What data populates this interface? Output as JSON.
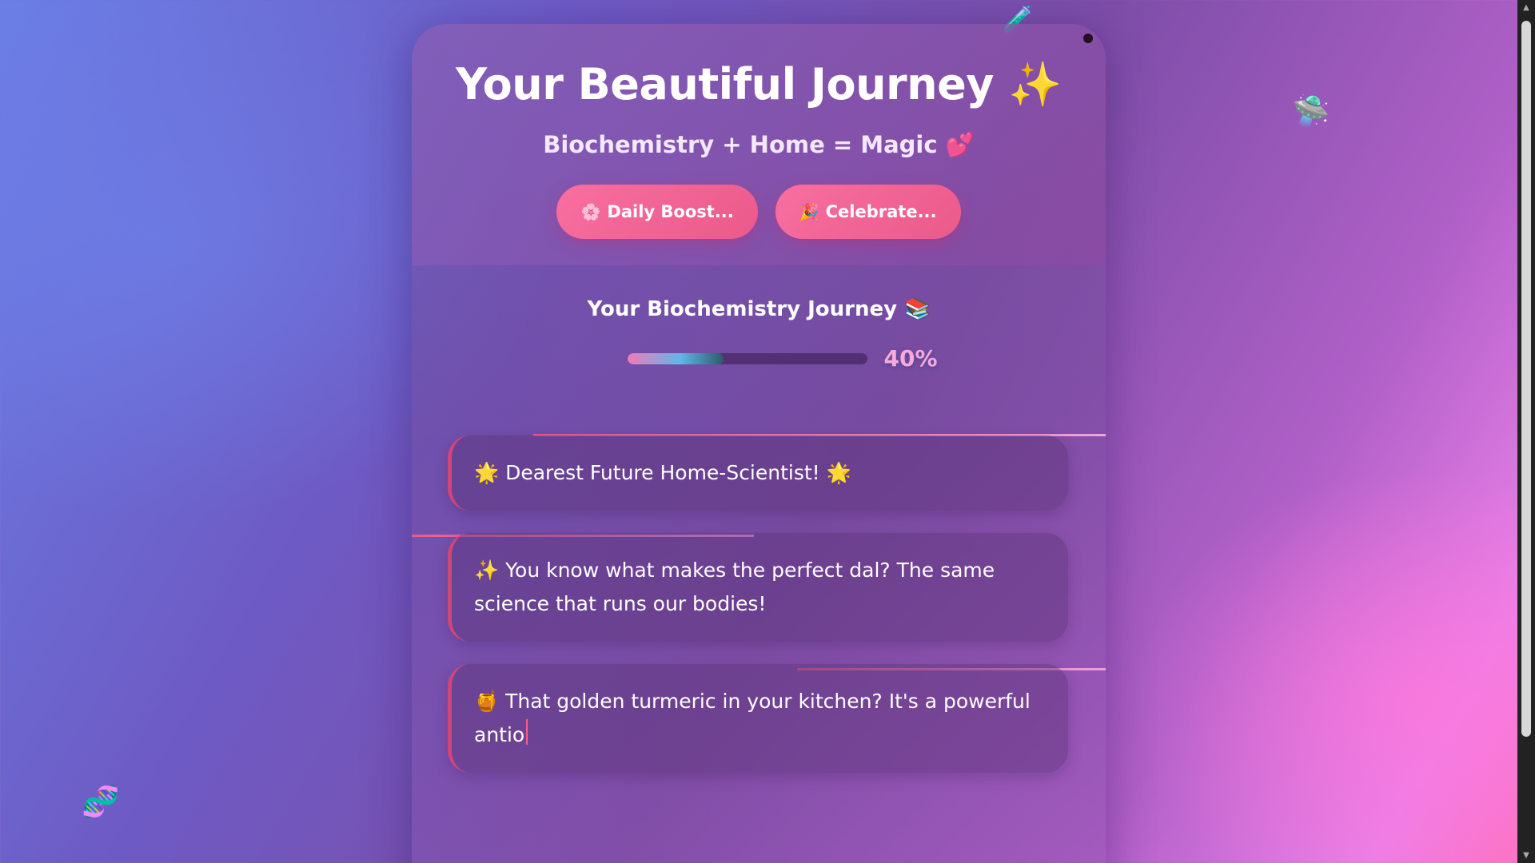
{
  "header": {
    "title": "Your Beautiful Journey ✨",
    "subtitle": "Biochemistry + Home = Magic 💕",
    "buttons": [
      {
        "icon": "🌸",
        "label": "Daily Boost..."
      },
      {
        "icon": "🎉",
        "label": "Celebrate..."
      }
    ]
  },
  "progress": {
    "title": "Your Biochemistry Journey 📚",
    "value": 0.4,
    "label": "40%"
  },
  "messages": [
    {
      "text": "🌟 Dearest Future Home-Scientist! 🌟"
    },
    {
      "text": "✨ You know what makes the perfect dal? The same science that runs our bodies!"
    },
    {
      "text": "🍯 That golden turmeric in your kitchen? It's a powerful antio"
    }
  ],
  "floating_icons": [
    "flask-icon",
    "alien-lab-icon",
    "dna-icon"
  ],
  "colors": {
    "accent": "#f86fa0",
    "progress_pct": "#f7a9d8"
  }
}
